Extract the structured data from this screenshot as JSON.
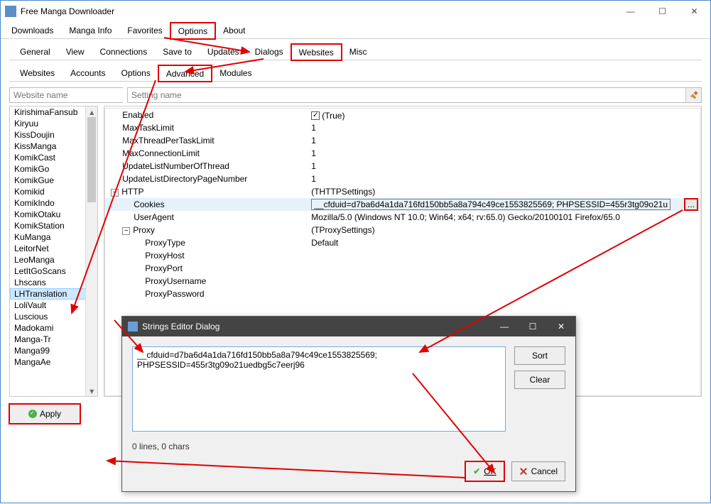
{
  "window": {
    "title": "Free Manga Downloader"
  },
  "main_tabs": [
    "Downloads",
    "Manga Info",
    "Favorites",
    "Options",
    "About"
  ],
  "main_tabs_active": 3,
  "opt_tabs": [
    "General",
    "View",
    "Connections",
    "Save to",
    "Updates",
    "Dialogs",
    "Websites",
    "Misc"
  ],
  "opt_tabs_active": 6,
  "web_tabs": [
    "Websites",
    "Accounts",
    "Options",
    "Advanced",
    "Modules"
  ],
  "web_tabs_active": 3,
  "search_left_placeholder": "Website name",
  "search_right_placeholder": "Setting name",
  "website_list": [
    "KirishimaFansub",
    "Kiryuu",
    "KissDoujin",
    "KissManga",
    "KomikCast",
    "KomikGo",
    "KomikGue",
    "Komikid",
    "KomikIndo",
    "KomikOtaku",
    "KomikStation",
    "KuManga",
    "LeitorNet",
    "LeoManga",
    "LetItGoScans",
    "Lhscans",
    "LHTranslation",
    "LoliVault",
    "Luscious",
    "Madokami",
    "Manga-Tr",
    "Manga99",
    "MangaAe"
  ],
  "website_selected": "LHTranslation",
  "props": {
    "enabled_label": "Enabled",
    "enabled_value": "(True)",
    "maxtask_label": "MaxTaskLimit",
    "maxtask_value": "1",
    "maxthread_label": "MaxThreadPerTaskLimit",
    "maxthread_value": "1",
    "maxconn_label": "MaxConnectionLimit",
    "maxconn_value": "1",
    "updlist_label": "UpdateListNumberOfThread",
    "updlist_value": "1",
    "updldir_label": "UpdateListDirectoryPageNumber",
    "updldir_value": "1",
    "http_label": "HTTP",
    "http_value": "(THTTPSettings)",
    "cookies_label": "Cookies",
    "cookies_value": "__cfduid=d7ba6d4a1da716fd150bb5a8a794c49ce1553825569; PHPSESSID=455r3tg09o21u",
    "ua_label": "UserAgent",
    "ua_value": "Mozilla/5.0 (Windows NT 10.0; Win64; x64; rv:65.0) Gecko/20100101 Firefox/65.0",
    "proxy_label": "Proxy",
    "proxy_value": "(TProxySettings)",
    "ptype_label": "ProxyType",
    "ptype_value": "Default",
    "phost_label": "ProxyHost",
    "pport_label": "ProxyPort",
    "puser_label": "ProxyUsername",
    "ppass_label": "ProxyPassword"
  },
  "apply_label": "Apply",
  "dialog": {
    "title": "Strings Editor Dialog",
    "text": "__cfduid=d7ba6d4a1da716fd150bb5a8a794c49ce1553825569;\nPHPSESSID=455r3tg09o21uedbg5c7eerj96",
    "sort_label": "Sort",
    "clear_label": "Clear",
    "status": "0 lines, 0 chars",
    "ok_label": "OK",
    "cancel_label": "Cancel"
  },
  "dots_label": "..."
}
